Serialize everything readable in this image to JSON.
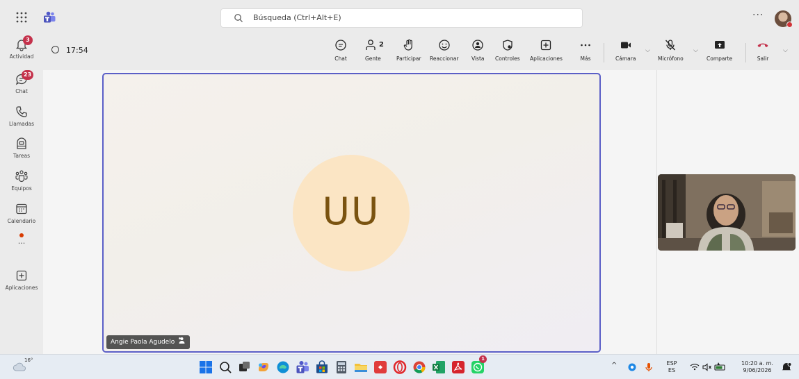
{
  "topbar": {
    "search_placeholder": "Búsqueda (Ctrl+Alt+E)",
    "more": "···"
  },
  "rail": {
    "items": [
      {
        "label": "Actividad",
        "badge": "3"
      },
      {
        "label": "Chat",
        "badge": "23"
      },
      {
        "label": "Llamadas"
      },
      {
        "label": "Tareas"
      },
      {
        "label": "Equipos"
      },
      {
        "label": "Calendario"
      },
      {
        "label": "···"
      },
      {
        "label": "Aplicaciones"
      }
    ]
  },
  "meeting": {
    "timer": "17:54",
    "toolbar": {
      "chat": "Chat",
      "people": "Gente",
      "people_count": "2",
      "raise": "Participar",
      "react": "Reaccionar",
      "view": "Vista",
      "controls": "Controles",
      "apps": "Aplicaciones",
      "more": "Más",
      "camera": "Cámara",
      "mic": "Micrófono",
      "share": "Comparte",
      "leave": "Salir"
    },
    "participant": {
      "initials": "UU",
      "name": "Angie Paola Agudelo"
    }
  },
  "taskbar": {
    "weather_temp": "16°",
    "lang_top": "ESP",
    "lang_bottom": "ES",
    "time": "10:20 a. m.",
    "date": "9/06/2026",
    "chrome_badge": "",
    "whatsapp_badge": "1"
  },
  "colors": {
    "accent": "#5b5fc7",
    "leave": "#c4314b",
    "badge": "#c4314b",
    "initials_bg": "#fbe5c4",
    "initials_fg": "#7a5310"
  }
}
